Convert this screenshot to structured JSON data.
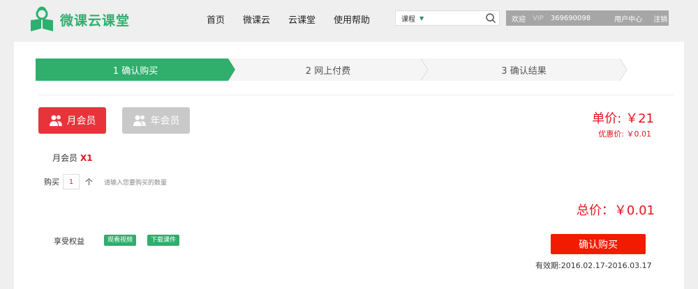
{
  "brand": {
    "name": "微课云课堂",
    "color": "#2eaf6e",
    "icon": "cloud-book-logo-icon"
  },
  "nav": {
    "items": [
      "首页",
      "微课云",
      "云课堂",
      "使用帮助"
    ]
  },
  "search": {
    "category": "课程",
    "placeholder": "",
    "value": "",
    "icon": "search-icon"
  },
  "userbar": {
    "welcome": "欢迎",
    "vip": "VIP",
    "user_id": "369690098",
    "center": "用户中心",
    "logout": "注销"
  },
  "steps": [
    {
      "label": "1 确认购买",
      "active": true
    },
    {
      "label": "2 网上付费",
      "active": false
    },
    {
      "label": "3 确认结果",
      "active": false
    }
  ],
  "plans": {
    "month": "月会员",
    "year": "年会员",
    "selected": "month"
  },
  "price": {
    "unit": "单价: ￥21",
    "discount": "优惠价: ￥0.01",
    "total": "总价：￥0.01"
  },
  "selection": {
    "name": "月会员",
    "count": "X1"
  },
  "purchase": {
    "label": "购买",
    "quantity": "1",
    "unit": "个",
    "hint": "请输入您要购买的数量"
  },
  "benefits": {
    "label": "享受权益",
    "items": [
      "观看视频",
      "下载课件"
    ]
  },
  "confirm": {
    "label": "确认购买",
    "validity": "有效期:2016.02.17-2016.03.17"
  },
  "colors": {
    "accent": "#2fae6c",
    "price": "#e0141d",
    "button": "#f21b00"
  }
}
